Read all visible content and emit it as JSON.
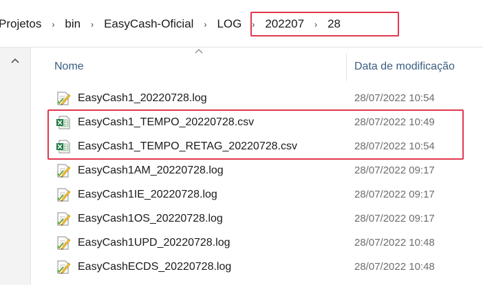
{
  "breadcrumb": {
    "items": [
      "Projetos",
      "bin",
      "EasyCash-Oficial",
      "LOG",
      "202207",
      "28"
    ],
    "separator": "›"
  },
  "list": {
    "columns": {
      "name": "Nome",
      "date": "Data de modificação"
    },
    "files": [
      {
        "name": "EasyCash1_20220728.log",
        "date": "28/07/2022 10:54",
        "icon": "log-file-icon"
      },
      {
        "name": "EasyCash1_TEMPO_20220728.csv",
        "date": "28/07/2022 10:49",
        "icon": "csv-file-icon"
      },
      {
        "name": "EasyCash1_TEMPO_RETAG_20220728.csv",
        "date": "28/07/2022 10:54",
        "icon": "csv-file-icon"
      },
      {
        "name": "EasyCash1AM_20220728.log",
        "date": "28/07/2022 09:17",
        "icon": "log-file-icon"
      },
      {
        "name": "EasyCash1IE_20220728.log",
        "date": "28/07/2022 09:17",
        "icon": "log-file-icon"
      },
      {
        "name": "EasyCash1OS_20220728.log",
        "date": "28/07/2022 09:17",
        "icon": "log-file-icon"
      },
      {
        "name": "EasyCash1UPD_20220728.log",
        "date": "28/07/2022 10:48",
        "icon": "log-file-icon"
      },
      {
        "name": "EasyCashECDS_20220728.log",
        "date": "28/07/2022 10:48",
        "icon": "log-file-icon"
      }
    ]
  },
  "colors": {
    "highlight": "#e0364d",
    "header_text": "#3b5d80",
    "date_text": "#6d6d6d"
  }
}
